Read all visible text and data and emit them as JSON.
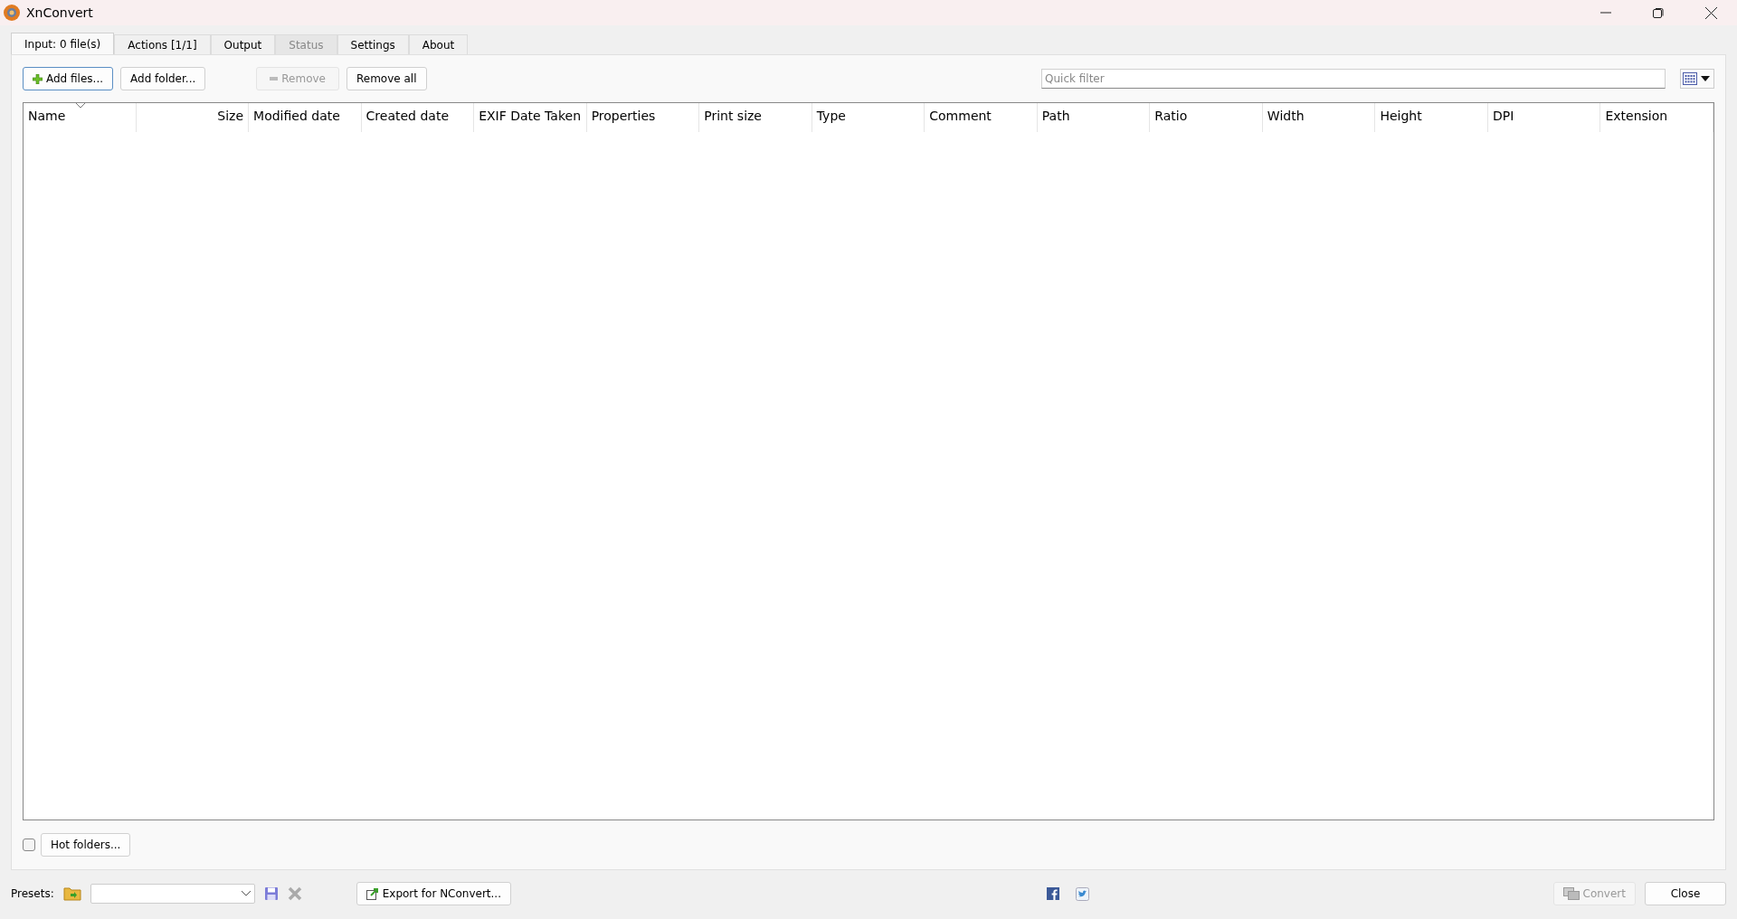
{
  "window": {
    "title": "XnConvert"
  },
  "tabs": [
    {
      "label": "Input: 0 file(s)",
      "selected": true,
      "disabled": false
    },
    {
      "label": "Actions [1/1]",
      "selected": false,
      "disabled": false
    },
    {
      "label": "Output",
      "selected": false,
      "disabled": false
    },
    {
      "label": "Status",
      "selected": false,
      "disabled": true
    },
    {
      "label": "Settings",
      "selected": false,
      "disabled": false
    },
    {
      "label": "About",
      "selected": false,
      "disabled": false
    }
  ],
  "toolbar": {
    "add_files": {
      "label": "Add files...",
      "disabled": false
    },
    "add_folder": {
      "label": "Add folder...",
      "disabled": false
    },
    "remove": {
      "label": "Remove",
      "disabled": true
    },
    "remove_all": {
      "label": "Remove all",
      "disabled": false
    }
  },
  "search": {
    "placeholder": "Quick filter"
  },
  "table": {
    "columns": [
      {
        "label": "Name",
        "sorted": true
      },
      {
        "label": "Size",
        "sorted": false
      },
      {
        "label": "Modified date",
        "sorted": false
      },
      {
        "label": "Created date",
        "sorted": false
      },
      {
        "label": "EXIF Date Taken",
        "sorted": false
      },
      {
        "label": "Properties",
        "sorted": false
      },
      {
        "label": "Print size",
        "sorted": false
      },
      {
        "label": "Type",
        "sorted": false
      },
      {
        "label": "Comment",
        "sorted": false
      },
      {
        "label": "Path",
        "sorted": false
      },
      {
        "label": "Ratio",
        "sorted": false
      },
      {
        "label": "Width",
        "sorted": false
      },
      {
        "label": "Height",
        "sorted": false
      },
      {
        "label": "DPI",
        "sorted": false
      },
      {
        "label": "Extension",
        "sorted": false
      }
    ]
  },
  "hot_folders": {
    "checked": false,
    "label": "Hot folders..."
  },
  "bottom": {
    "presets_label": "Presets:",
    "export": "Export for NConvert...",
    "convert": {
      "label": "Convert",
      "disabled": true
    },
    "close": "Close"
  }
}
